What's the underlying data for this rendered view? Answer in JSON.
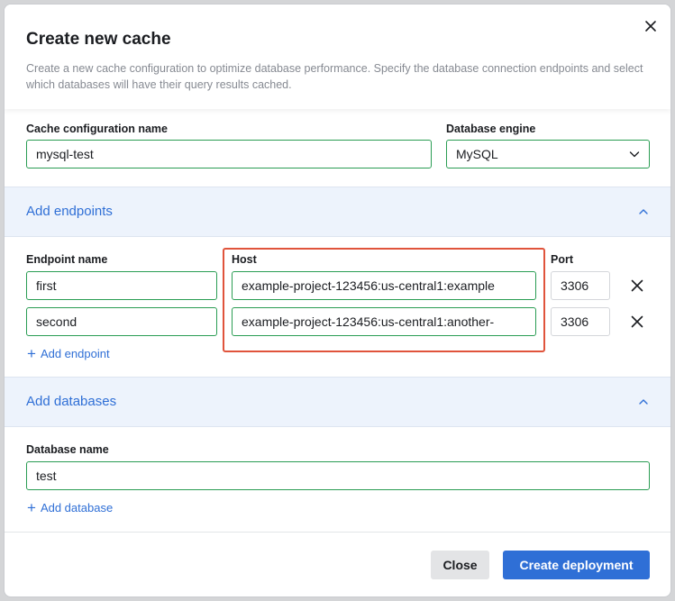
{
  "dialog": {
    "title": "Create new cache",
    "description": "Create a new cache configuration to optimize database performance. Specify the database connection endpoints and select which databases will have their query results cached.",
    "close_icon": "close-icon"
  },
  "config": {
    "name_label": "Cache configuration name",
    "name_value": "mysql-test",
    "engine_label": "Database engine",
    "engine_value": "MySQL"
  },
  "endpoints": {
    "section_title": "Add endpoints",
    "endpoint_name_label": "Endpoint name",
    "host_label": "Host",
    "port_label": "Port",
    "rows": [
      {
        "name": "first",
        "host": "example-project-123456:us-central1:example",
        "port": "3306"
      },
      {
        "name": "second",
        "host": "example-project-123456:us-central1:another-",
        "port": "3306"
      }
    ],
    "add_label": "Add endpoint"
  },
  "databases": {
    "section_title": "Add databases",
    "name_label": "Database name",
    "name_value": "test",
    "add_label": "Add database"
  },
  "footer": {
    "close_label": "Close",
    "create_label": "Create deployment"
  },
  "colors": {
    "accent": "#2f6fd6",
    "valid_border": "#2a9d53",
    "highlight": "#e0543c"
  }
}
